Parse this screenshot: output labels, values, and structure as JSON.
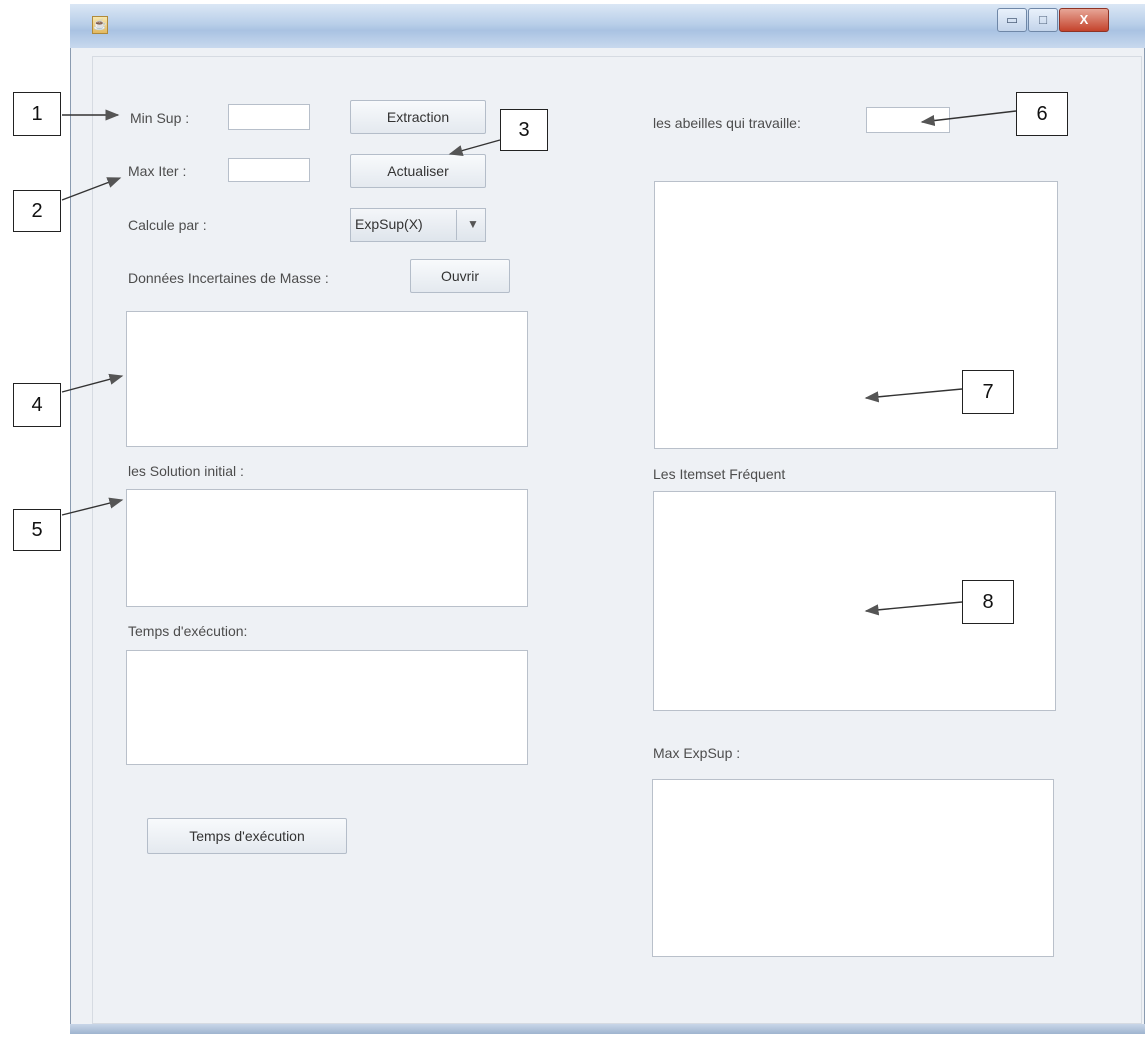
{
  "window": {
    "title": "",
    "controls": {
      "minimize_glyph": "▭",
      "maximize_glyph": "□",
      "close_glyph": "X"
    }
  },
  "form": {
    "min_sup_label": "Min Sup :",
    "min_sup_value": "",
    "max_iter_label": "Max Iter :",
    "max_iter_value": "",
    "extraction_button": "Extraction",
    "actualiser_button": "Actualiser",
    "calcule_label": "Calcule par :",
    "calcule_selected": "ExpSup(X)",
    "donnees_label": "Données Incertaines de Masse :",
    "ouvrir_button": "Ouvrir",
    "solution_label": "les Solution initial :",
    "temps_label": "Temps d'exécution:",
    "temps_button": "Temps d'exécution",
    "abeilles_label": "les abeilles qui travaille:",
    "abeilles_value": "",
    "itemset_label": "Les Itemset Fréquent",
    "max_expsup_label": "Max ExpSup :"
  },
  "callouts": [
    "1",
    "2",
    "3",
    "4",
    "5",
    "6",
    "7",
    "8"
  ],
  "icons": {
    "app_icon": "java-cup-icon",
    "combo_arrow": "chevron-down-icon"
  }
}
